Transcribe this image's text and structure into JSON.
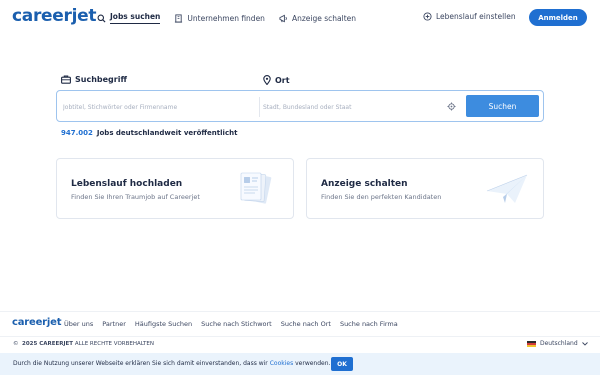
{
  "header": {
    "logo": "careerjet",
    "nav": [
      {
        "label": "Jobs suchen",
        "icon": "search-icon",
        "active": true
      },
      {
        "label": "Unternehmen finden",
        "icon": "building-icon",
        "active": false
      },
      {
        "label": "Anzeige schalten",
        "icon": "megaphone-icon",
        "active": false
      }
    ],
    "cv_link": "Lebenslauf einstellen",
    "login": "Anmelden"
  },
  "search": {
    "keyword_label": "Suchbegriff",
    "location_label": "Ort",
    "keyword_placeholder": "Jobtitel, Stichwörter oder Firmenname",
    "location_placeholder": "Stadt, Bundesland oder Staat",
    "button": "Suchen"
  },
  "jobs_count": {
    "number": "947.002",
    "text": "Jobs deutschlandweit veröffentlicht"
  },
  "cards": [
    {
      "title": "Lebenslauf hochladen",
      "subtitle": "Finden Sie Ihren Traumjob auf Careerjet",
      "icon": "documents-icon"
    },
    {
      "title": "Anzeige schalten",
      "subtitle": "Finden Sie den perfekten Kandidaten",
      "icon": "paper-plane-icon"
    }
  ],
  "footer": {
    "logo": "careerjet",
    "links": [
      "Über uns",
      "Partner",
      "Häufigste Suchen",
      "Suche nach Stichwort",
      "Suche nach Ort",
      "Suche nach Firma"
    ],
    "copyright_symbol": "©",
    "copyright_year_brand": "2025 CAREERJET",
    "copyright_rest": "ALLE RECHTE VORBEHALTEN",
    "language": "Deutschland"
  },
  "cookie": {
    "text_before": "Durch die Nutzung unserer Webseite erklären Sie sich damit einverstanden, dass wir",
    "link": "Cookies",
    "text_after": "verwenden.",
    "ok": "OK"
  },
  "colors": {
    "brand": "#1b5fae",
    "primary": "#1f6fd1",
    "search_button": "#3d8cdf",
    "cookie_bg": "#eaf3fc"
  }
}
